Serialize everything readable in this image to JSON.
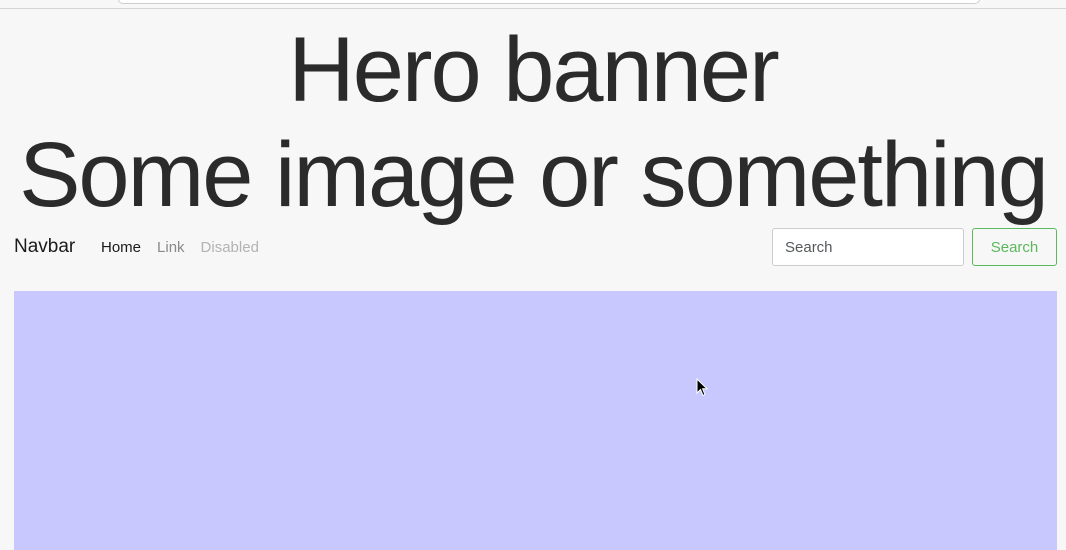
{
  "hero": {
    "line1": "Hero banner",
    "line2": "Some image or something"
  },
  "navbar": {
    "brand": "Navbar",
    "links": [
      {
        "label": "Home",
        "state": "active"
      },
      {
        "label": "Link",
        "state": "normal"
      },
      {
        "label": "Disabled",
        "state": "disabled"
      }
    ],
    "search": {
      "placeholder": "Search",
      "button_label": "Search"
    }
  },
  "colors": {
    "page_background": "#f7f7f7",
    "content_block": "#c8c8ff",
    "search_button_accent": "#5cb85c"
  },
  "icons": {
    "cursor": "mouse-pointer-icon"
  }
}
